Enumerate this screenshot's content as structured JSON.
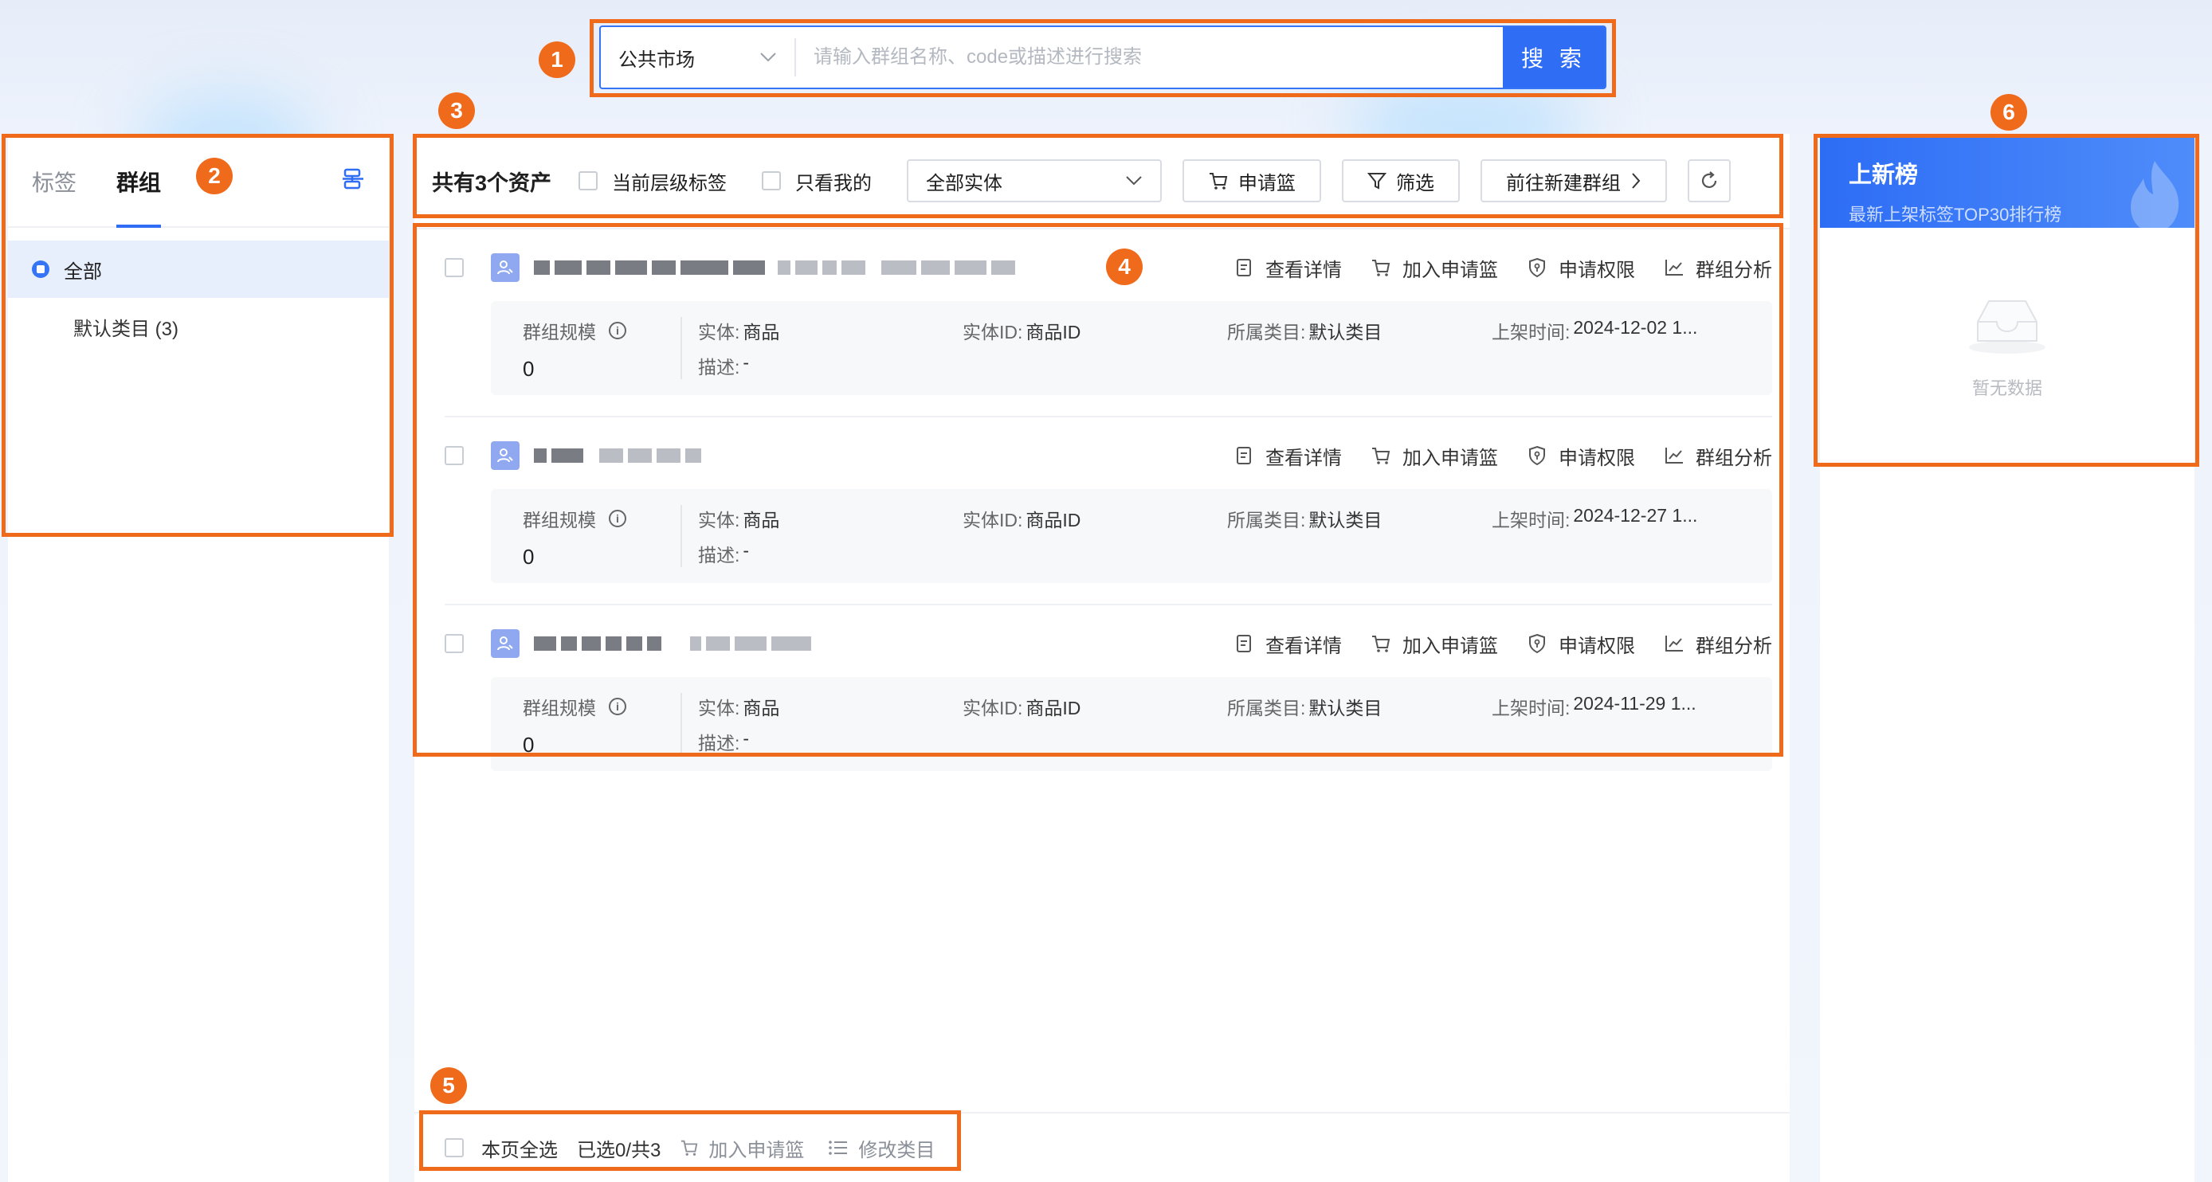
{
  "search": {
    "market": "公共市场",
    "placeholder": "请输入群组名称、code或描述进行搜索",
    "button": "搜 索"
  },
  "annotations": [
    "1",
    "2",
    "3",
    "4",
    "5",
    "6"
  ],
  "sidebar": {
    "tabs": [
      {
        "label": "标签",
        "active": false
      },
      {
        "label": "群组",
        "active": true
      }
    ],
    "tree": {
      "all_label": "全部",
      "items": [
        {
          "label": "默认类目 (3)"
        }
      ]
    }
  },
  "toolbar": {
    "total": "共有3个资产",
    "checkbox_current_level": "当前层级标签",
    "checkbox_mine": "只看我的",
    "entity_select": "全部实体",
    "basket_button": "申请篮",
    "filter_button": "筛选",
    "create_group_button": "前往新建群组"
  },
  "items": [
    {
      "actions": {
        "detail": "查看详情",
        "add_basket": "加入申请篮",
        "permission": "申请权限",
        "analysis": "群组分析"
      },
      "scale_label": "群组规模",
      "scale_value": "0",
      "entity_label": "实体:",
      "entity_value": "商品",
      "entity_id_label": "实体ID:",
      "entity_id_value": "商品ID",
      "category_label": "所属类目:",
      "category_value": "默认类目",
      "time_label": "上架时间:",
      "time_value": "2024-12-02 1...",
      "desc_label": "描述:",
      "desc_value": "-"
    },
    {
      "actions": {
        "detail": "查看详情",
        "add_basket": "加入申请篮",
        "permission": "申请权限",
        "analysis": "群组分析"
      },
      "scale_label": "群组规模",
      "scale_value": "0",
      "entity_label": "实体:",
      "entity_value": "商品",
      "entity_id_label": "实体ID:",
      "entity_id_value": "商品ID",
      "category_label": "所属类目:",
      "category_value": "默认类目",
      "time_label": "上架时间:",
      "time_value": "2024-12-27 1...",
      "desc_label": "描述:",
      "desc_value": "-"
    },
    {
      "actions": {
        "detail": "查看详情",
        "add_basket": "加入申请篮",
        "permission": "申请权限",
        "analysis": "群组分析"
      },
      "scale_label": "群组规模",
      "scale_value": "0",
      "entity_label": "实体:",
      "entity_value": "商品",
      "entity_id_label": "实体ID:",
      "entity_id_value": "商品ID",
      "category_label": "所属类目:",
      "category_value": "默认类目",
      "time_label": "上架时间:",
      "time_value": "2024-11-29 1...",
      "desc_label": "描述:",
      "desc_value": "-"
    }
  ],
  "footer": {
    "select_page": "本页全选",
    "selected_count": "已选0/共3",
    "add_basket": "加入申请篮",
    "modify_category": "修改类目"
  },
  "ranking": {
    "title": "上新榜",
    "subtitle": "最新上架标签TOP30排行榜",
    "empty_text": "暂无数据"
  },
  "colors": {
    "accent": "#2f6df5",
    "annotation": "#f06a1c"
  }
}
